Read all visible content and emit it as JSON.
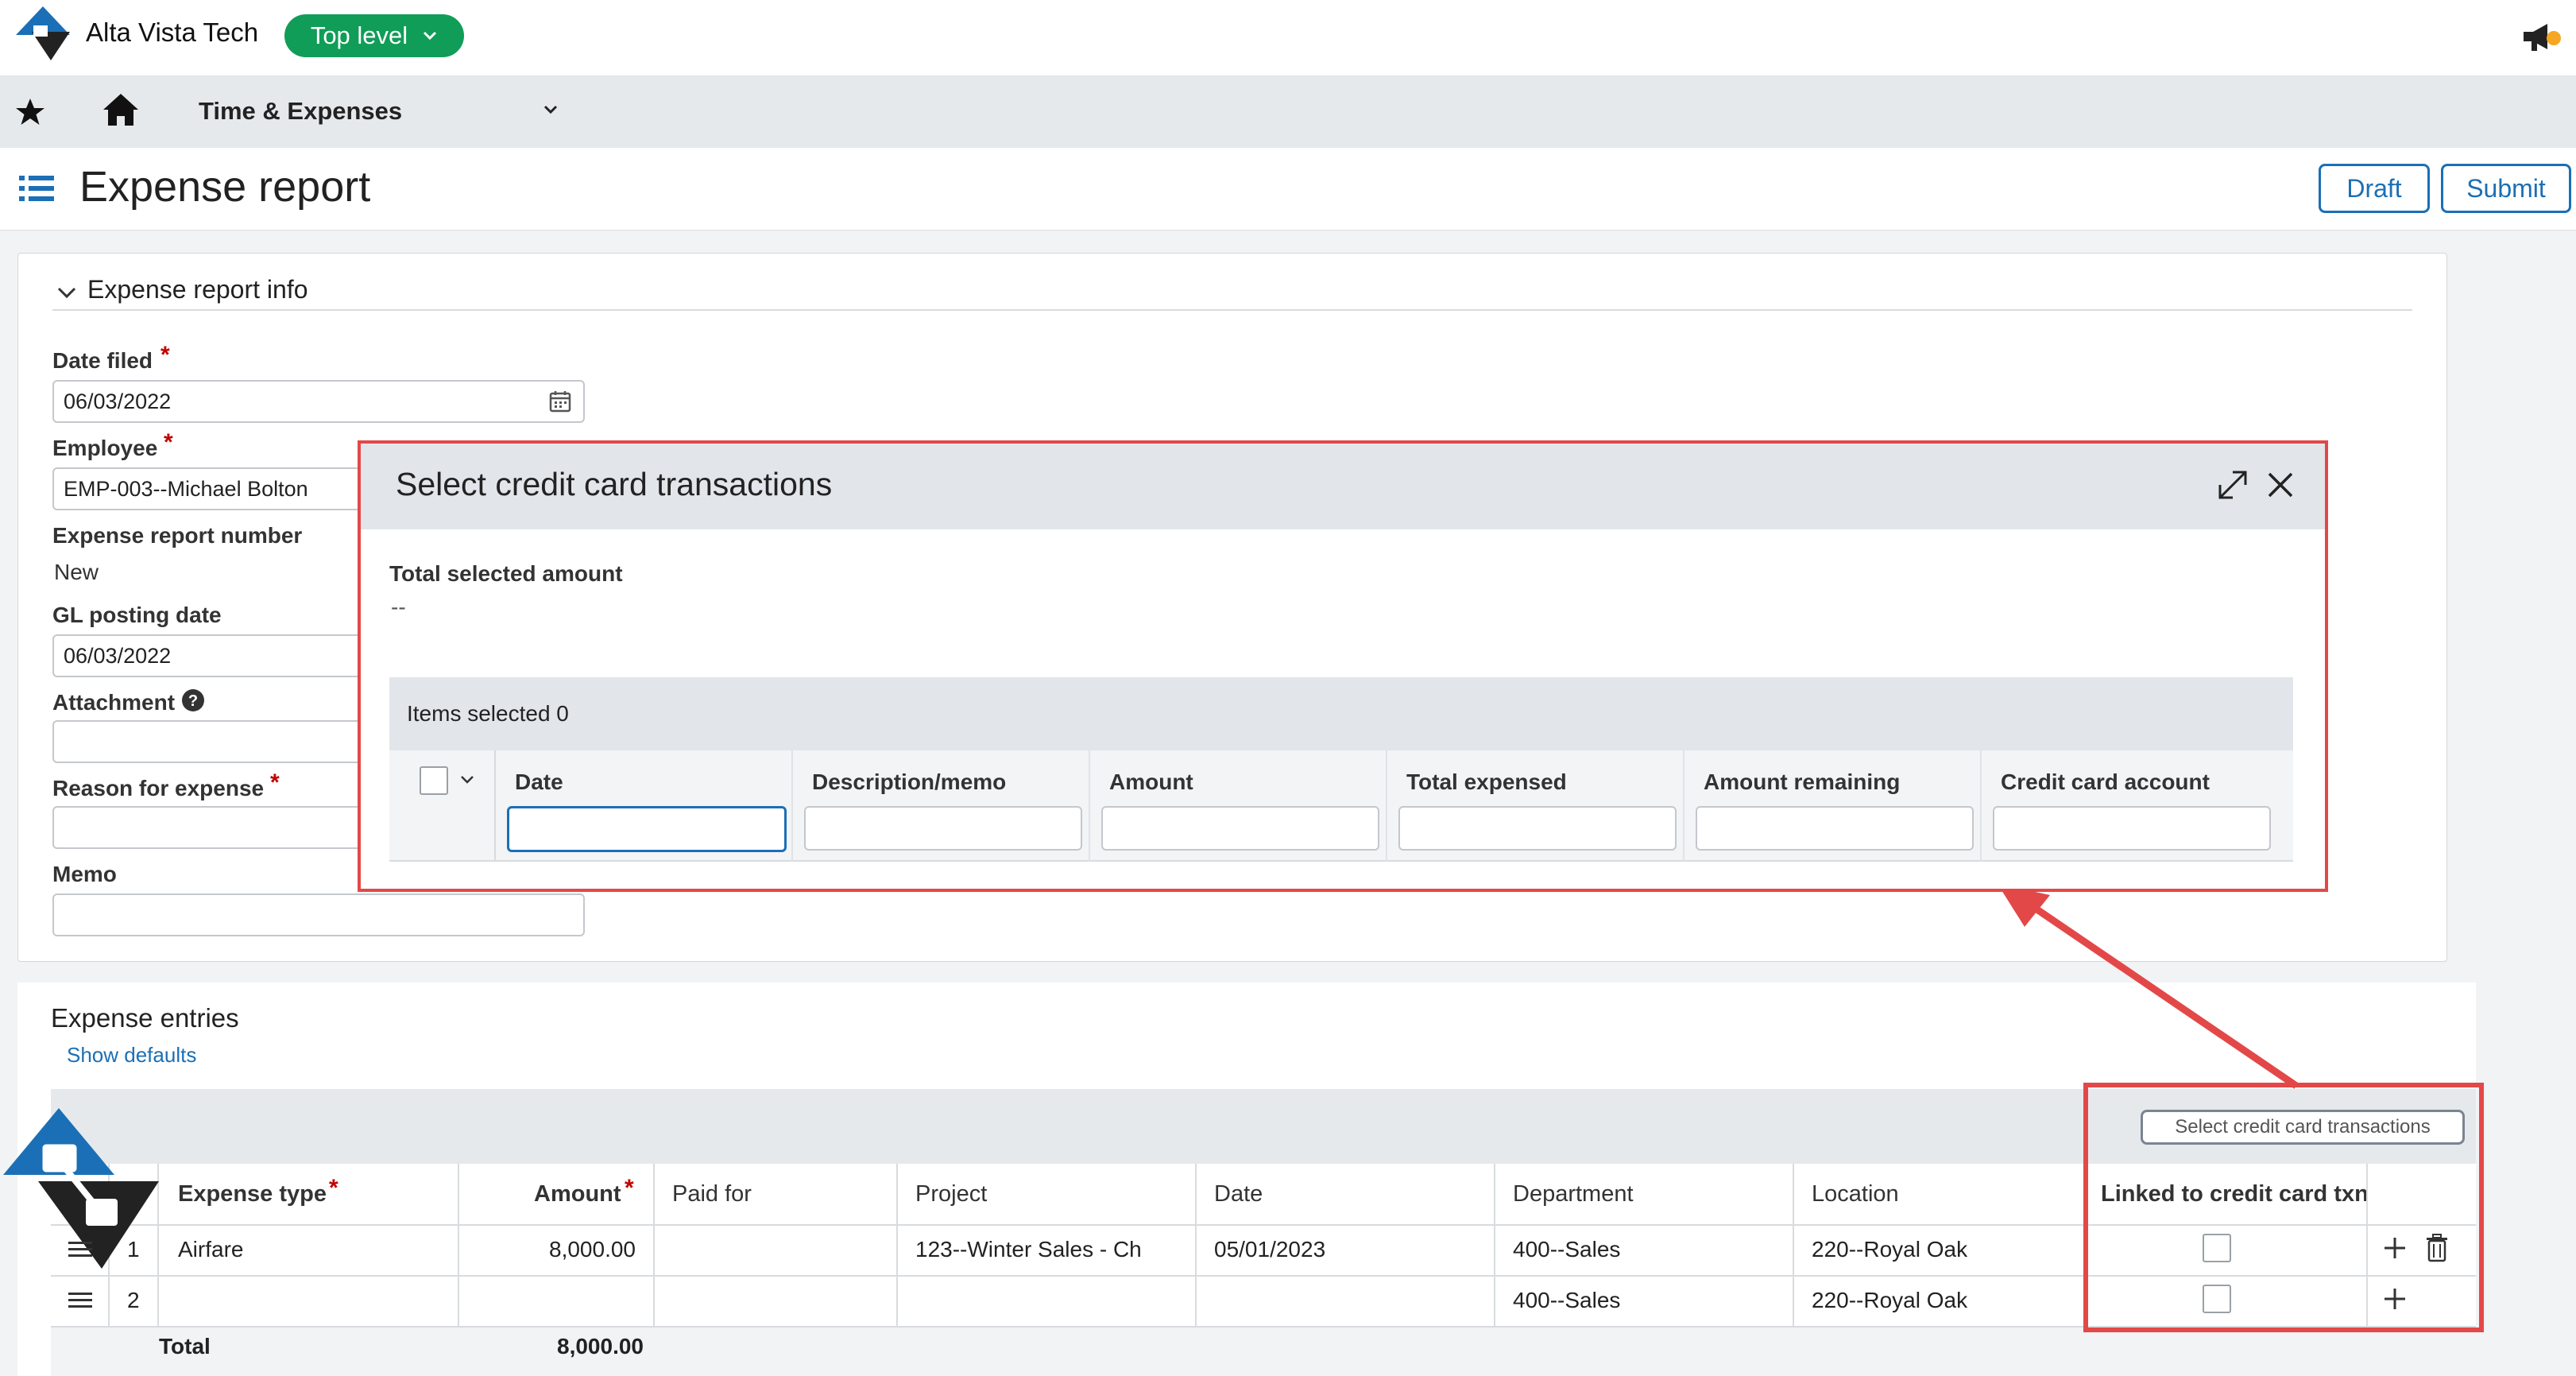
{
  "header": {
    "company": "Alta Vista Tech",
    "level_pill": "Top level"
  },
  "nav": {
    "module": "Time & Expenses"
  },
  "page": {
    "title": "Expense report",
    "draft_button": "Draft",
    "submit_button": "Submit"
  },
  "info_section": {
    "title": "Expense report info",
    "date_filed_label": "Date filed",
    "date_filed_value": "06/03/2022",
    "employee_label": "Employee",
    "employee_value": "EMP-003--Michael Bolton",
    "report_number_label": "Expense report number",
    "report_number_value": "New",
    "gl_posting_label": "GL posting date",
    "gl_posting_value": "06/03/2022",
    "attachment_label": "Attachment",
    "reason_label": "Reason for expense",
    "memo_label": "Memo",
    "required_mark": "*"
  },
  "modal": {
    "title": "Select credit card transactions",
    "total_label": "Total selected amount",
    "total_value": "--",
    "items_selected": "Items selected 0",
    "columns": [
      "Date",
      "Description/memo",
      "Amount",
      "Total expensed",
      "Amount remaining",
      "Credit card account"
    ]
  },
  "entries": {
    "title": "Expense entries",
    "show_defaults": "Show defaults",
    "select_cc_button": "Select credit card transactions",
    "columns": {
      "expense_type": "Expense type",
      "amount": "Amount",
      "paid_for": "Paid for",
      "project": "Project",
      "date": "Date",
      "department": "Department",
      "location": "Location",
      "linked": "Linked to credit card txn"
    },
    "rows": [
      {
        "num": "1",
        "expense_type": "Airfare",
        "amount": "8,000.00",
        "paid_for": "",
        "project": "123--Winter Sales - Ch",
        "date": "05/01/2023",
        "department": "400--Sales",
        "location": "220--Royal Oak"
      },
      {
        "num": "2",
        "expense_type": "",
        "amount": "",
        "paid_for": "",
        "project": "",
        "date": "",
        "department": "400--Sales",
        "location": "220--Royal Oak"
      }
    ],
    "total_label": "Total",
    "total_value": "8,000.00"
  },
  "colors": {
    "accent": "#1b6fb6",
    "pill": "#0f9d58",
    "highlight": "#e34848",
    "required": "#c40000"
  }
}
